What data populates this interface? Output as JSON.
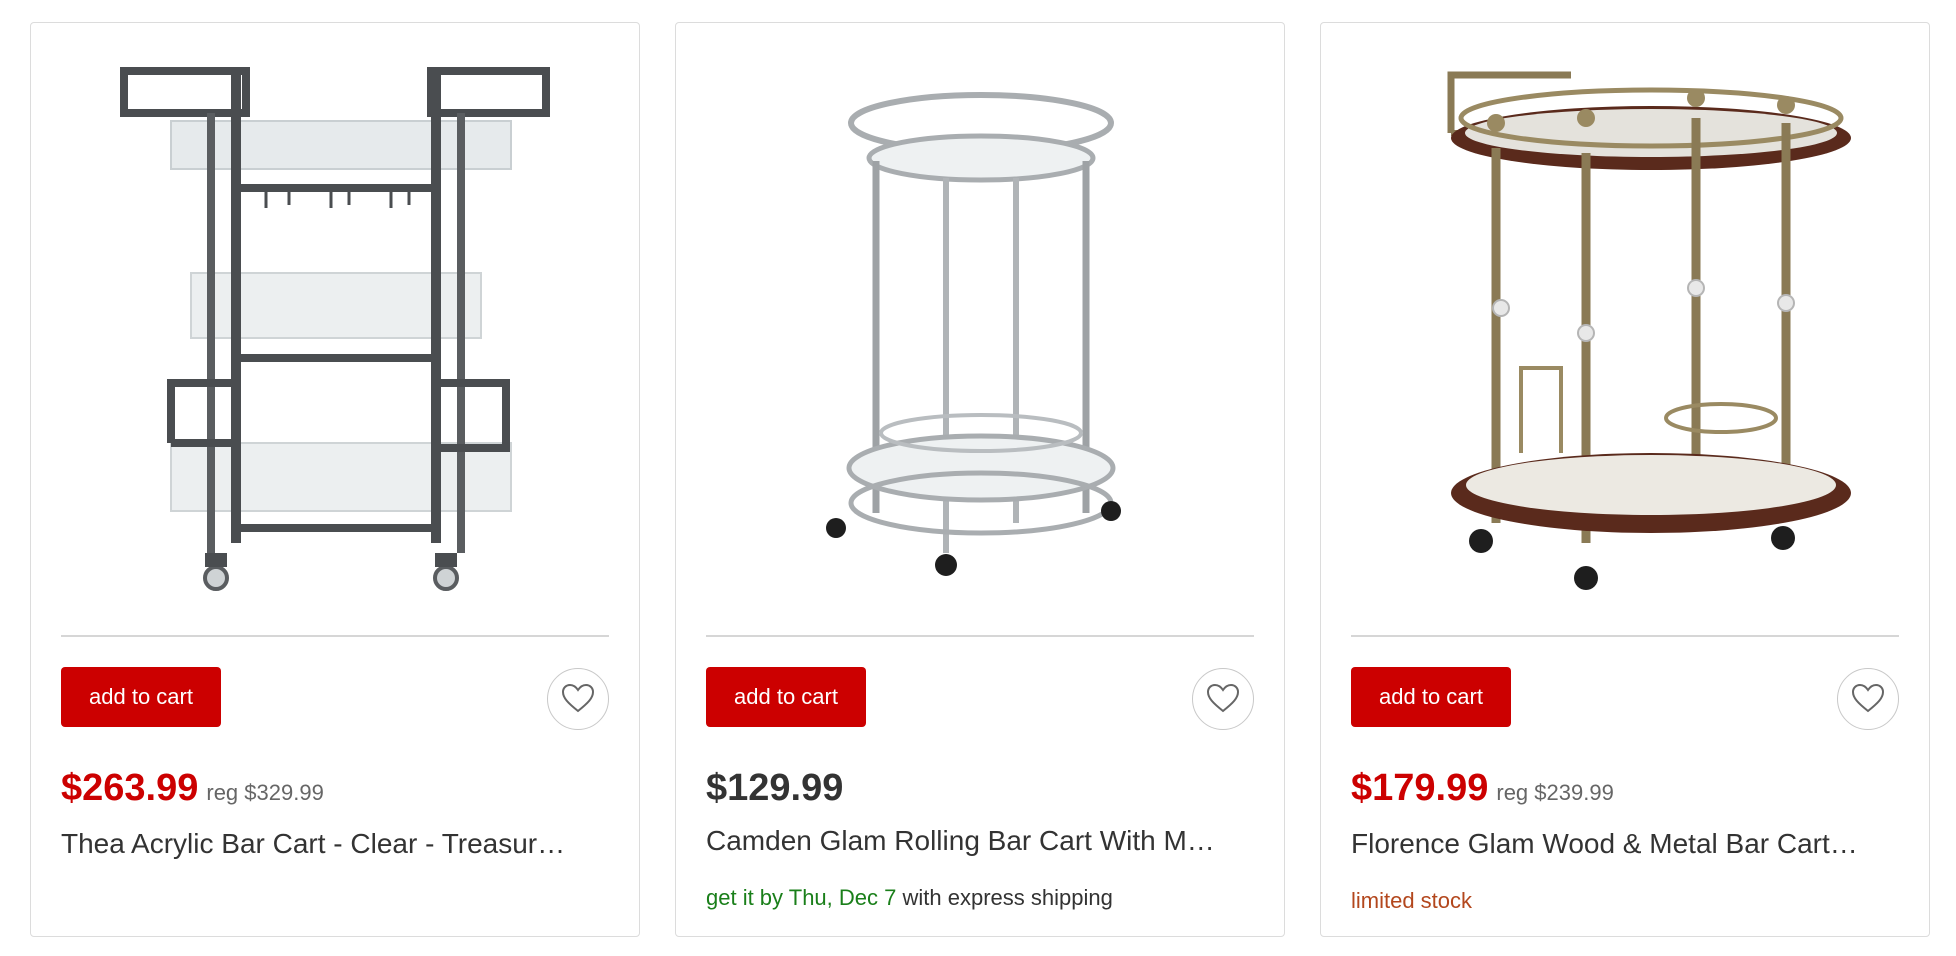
{
  "products": [
    {
      "image_alt": "Thea Acrylic Bar Cart",
      "add_label": "add to cart",
      "price": "$263.99",
      "reg_price": "reg $329.99",
      "title": "Thea Acrylic Bar Cart - Clear - Treasur…",
      "on_sale": true
    },
    {
      "image_alt": "Camden Glam Rolling Bar Cart",
      "add_label": "add to cart",
      "price": "$129.99",
      "title": "Camden Glam Rolling Bar Cart With M…",
      "shipping_green": "get it by Thu, Dec 7",
      "shipping_rest": " with express shipping",
      "on_sale": false
    },
    {
      "image_alt": "Florence Glam Wood & Metal Bar Cart",
      "add_label": "add to cart",
      "price": "$179.99",
      "reg_price": "reg $239.99",
      "title": "Florence Glam Wood & Metal Bar Cart…",
      "stock": "limited stock",
      "on_sale": true
    }
  ],
  "colors": {
    "sale_red": "#cc0000",
    "text_dark": "#333333",
    "shipping_green": "#1a7f1a",
    "stock_orange": "#b3471d"
  },
  "icons": {
    "favorite": "heart-icon"
  }
}
